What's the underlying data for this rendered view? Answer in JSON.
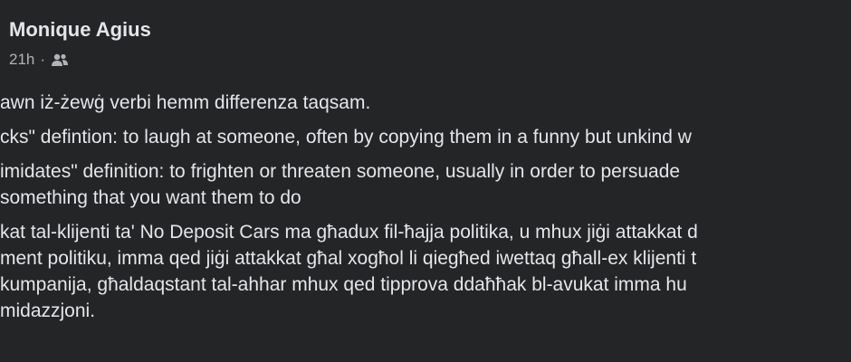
{
  "post": {
    "author": "Monique Agius",
    "timestamp": "21h",
    "separator": "·",
    "audience_icon": "friends-icon",
    "paragraphs": [
      [
        "awn iż-żewġ verbi hemm differenza taqsam."
      ],
      [
        "cks\" defintion: to laugh at someone, often by copying them in a funny but unkind w"
      ],
      [
        "imidates\" definition: to frighten or threaten someone, usually in order to persuade",
        "something that you want them to do"
      ],
      [
        "kat tal-klijenti ta' No Deposit Cars ma għadux fil-ħajja politika, u mhux jiġi attakkat d",
        "ment politiku, imma qed jiġi attakkat għal xogħol li qiegħed iwettaq għall-ex klijenti t",
        "kumpanija, għaldaqstant tal-ahhar mhux qed tipprova ddaħħak bl-avukat imma hu",
        "midazzjoni."
      ]
    ]
  }
}
